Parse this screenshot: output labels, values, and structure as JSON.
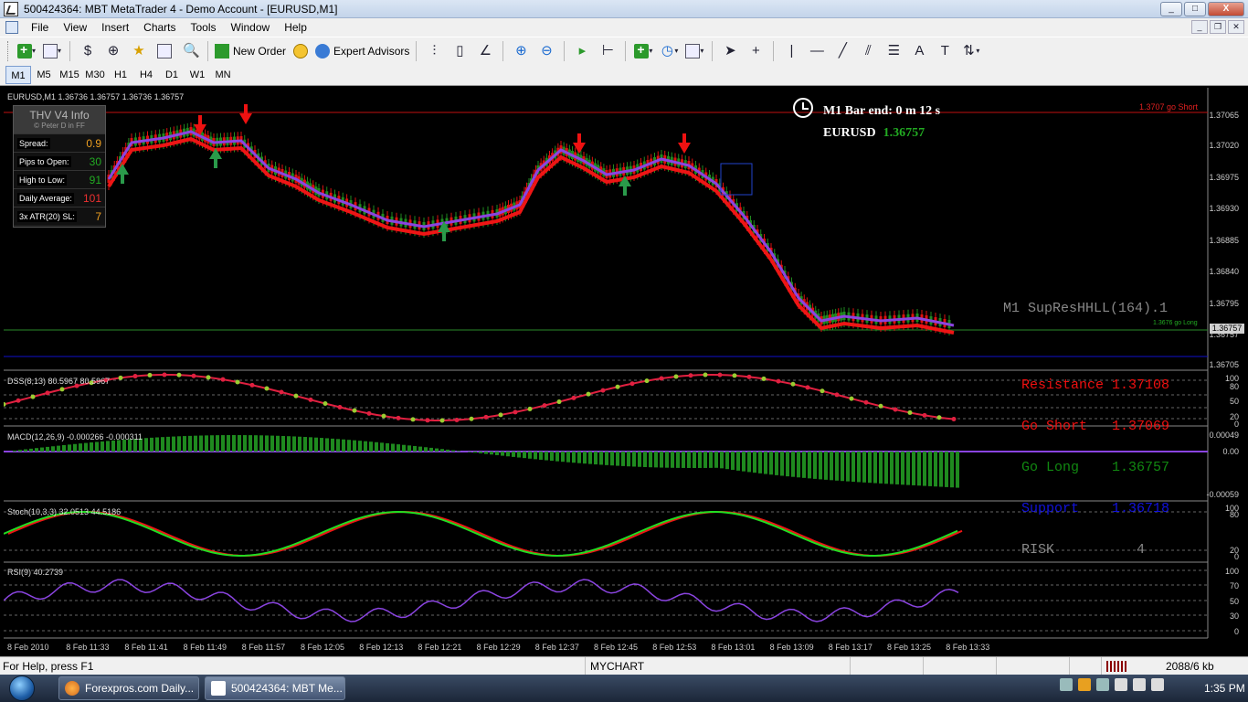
{
  "window": {
    "title": "500424364: MBT MetaTrader 4 - Demo Account - [EURUSD,M1]",
    "btn_min": "_",
    "btn_max": "□",
    "btn_close": "X"
  },
  "menu": [
    "File",
    "View",
    "Insert",
    "Charts",
    "Tools",
    "Window",
    "Help"
  ],
  "toolbar": {
    "new_order": "New Order",
    "expert_advisors": "Expert Advisors"
  },
  "timeframes": [
    "M1",
    "M5",
    "M15",
    "M30",
    "H1",
    "H4",
    "D1",
    "W1",
    "MN"
  ],
  "timeframe_active": "M1",
  "chart": {
    "header": "EURUSD,M1  1.36736 1.36757 1.36736 1.36757",
    "info_panel": {
      "title": "THV  V4  Info",
      "credit": "© Peter D in FF",
      "rows": [
        {
          "key": "Spread:",
          "value": "0.9",
          "color": "#f0a020"
        },
        {
          "key": "Pips to Open:",
          "value": "30",
          "color": "#22aa22"
        },
        {
          "key": "High to Low:",
          "value": "91",
          "color": "#22aa22"
        },
        {
          "key": "Daily Average:",
          "value": "101",
          "color": "#ee3030"
        },
        {
          "key": "3x ATR(20) SL:",
          "value": "7",
          "color": "#f0a020"
        }
      ]
    },
    "bar_end": "M1 Bar end: 0 m 12 s",
    "symbol": "EURUSD",
    "price": "1.36757",
    "go_short_tag": "1.3707 go Short",
    "go_long_tag": "1.3676 go Long",
    "supres": {
      "title": "M1 SupResHHLL(164).1",
      "resistance": "Resistance 1.37108",
      "go_short": "Go Short   1.37069",
      "go_long": "Go Long    1.36757",
      "support": "Support    1.36718",
      "risk": "RISK          4"
    },
    "price_axis": [
      "1.37065",
      "1.37020",
      "1.36975",
      "1.36930",
      "1.36885",
      "1.36840",
      "1.36795",
      "1.36757",
      "1.36705"
    ],
    "current_price_tag": "1.36757",
    "dss": {
      "label": "DSS(8,13) 80.5967 80.5967",
      "axis": [
        "100",
        "80",
        "50",
        "20",
        "0"
      ]
    },
    "macd": {
      "label": "MACD(12,26,9) -0.000266 -0.000311",
      "axis": [
        "0.00049",
        "0.00",
        "-0.00059"
      ]
    },
    "stoch": {
      "label": "Stoch(10,3,3) 32.0513 44.5186",
      "axis": [
        "100",
        "80",
        "20",
        "0"
      ]
    },
    "rsi": {
      "label": "RSI(9) 40.2739",
      "axis": [
        "100",
        "70",
        "50",
        "30",
        "0"
      ]
    },
    "time_axis": [
      "8 Feb 2010",
      "8 Feb 11:33",
      "8 Feb 11:41",
      "8 Feb 11:49",
      "8 Feb 11:57",
      "8 Feb 12:05",
      "8 Feb 12:13",
      "8 Feb 12:21",
      "8 Feb 12:29",
      "8 Feb 12:37",
      "8 Feb 12:45",
      "8 Feb 12:53",
      "8 Feb 13:01",
      "8 Feb 13:09",
      "8 Feb 13:17",
      "8 Feb 13:25",
      "8 Feb 13:33"
    ]
  },
  "status": {
    "help": "For Help, press F1",
    "profile": "MYCHART",
    "traffic": "2088/6 kb"
  },
  "taskbar": {
    "task1": "Forexpros.com Daily...",
    "task2": "500424364: MBT Me...",
    "clock": "1:35 PM"
  }
}
